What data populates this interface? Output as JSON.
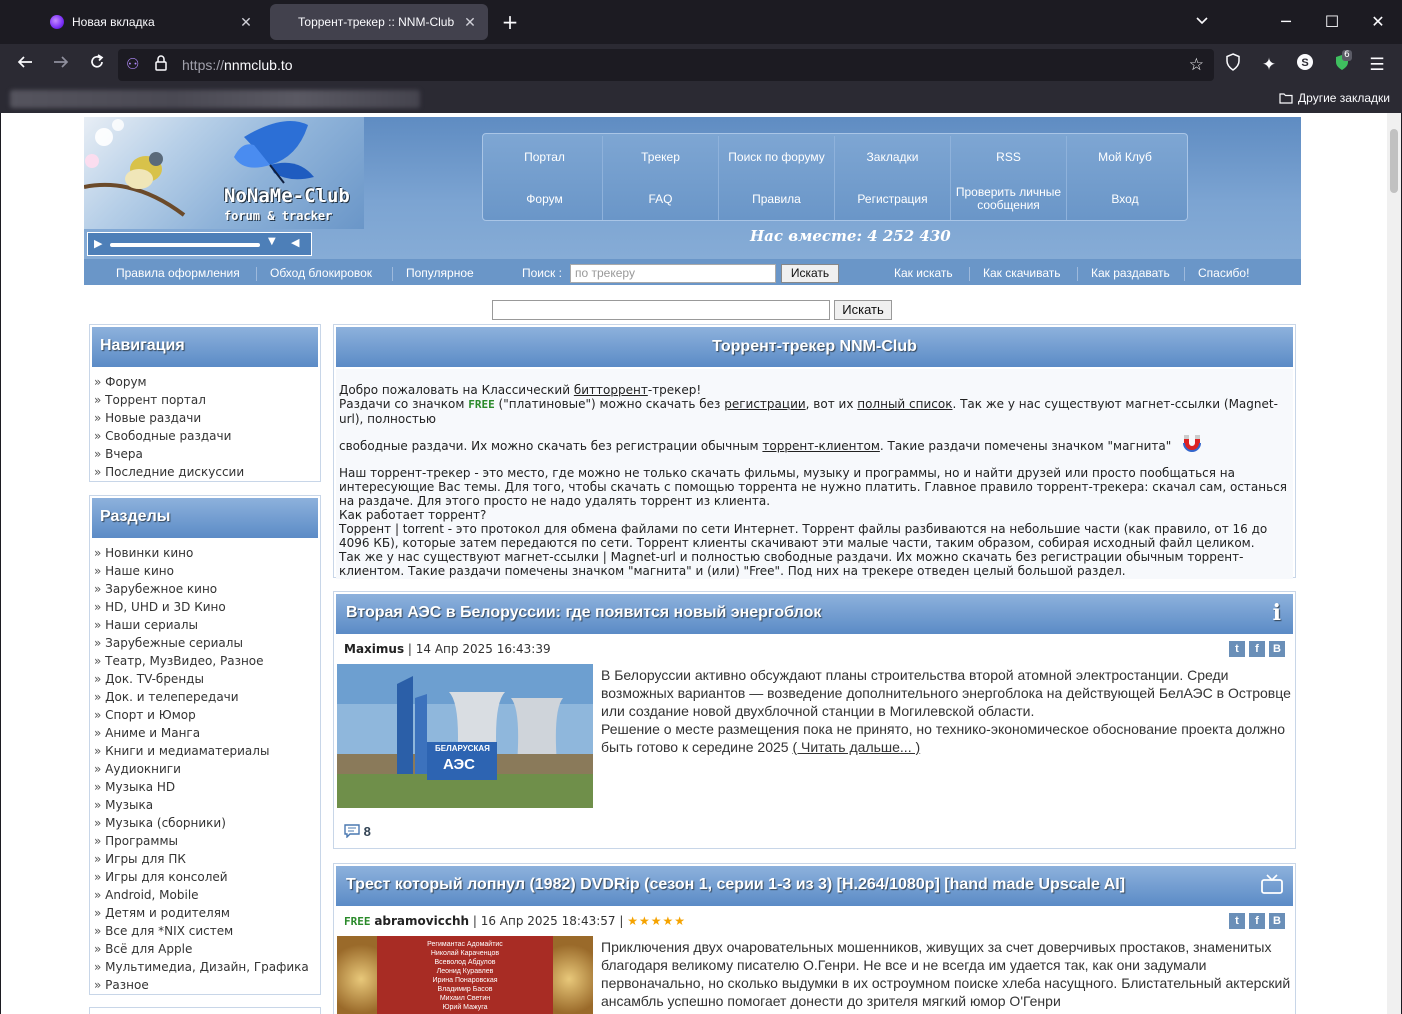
{
  "browser": {
    "tabs": [
      {
        "title": "Новая вкладка"
      },
      {
        "title": "Торрент-трекер :: NNM-Club"
      }
    ],
    "url_proto": "https://",
    "url_host": "nnmclub.to",
    "other_bookmarks": "Другие закладки",
    "ext_badge": "6"
  },
  "site": {
    "logo_title": "NoNaMe-Club",
    "logo_sub": "forum & tracker",
    "menu_row1": [
      "Портал",
      "Трекер",
      "Поиск по форуму",
      "Закладки",
      "RSS",
      "Мой Клуб"
    ],
    "menu_row2": [
      "Форум",
      "FAQ",
      "Правила",
      "Регистрация",
      "Проверить личные сообщения",
      "Вход"
    ],
    "together": "Нас вместе: 4 252 430",
    "nav_links_left": [
      "Правила оформления",
      "Обход блокировок",
      "Популярное"
    ],
    "search_label": "Поиск :",
    "search_placeholder": "по трекеру",
    "search_button": "Искать",
    "nav_links_right": [
      "Как искать",
      "Как скачивать",
      "Как раздавать",
      "Спасибо!"
    ],
    "main_search_button": "Искать"
  },
  "sidebar": {
    "nav_title": "Навигация",
    "nav_items": [
      "Форум",
      "Торрент портал",
      "Новые раздачи",
      "Свободные раздачи",
      "Вчера",
      "Последние дискуссии"
    ],
    "sections_title": "Разделы",
    "section_items": [
      "Новинки кино",
      "Наше кино",
      "Зарубежное кино",
      "HD, UHD и 3D Кино",
      "Наши сериалы",
      "Зарубежные сериалы",
      "Театр, МузВидео, Разное",
      "Док. TV-бренды",
      "Док. и телепередачи",
      "Спорт и Юмор",
      "Аниме и Манга",
      "Книги и медиаматериалы",
      "Аудиокниги",
      "Музыка HD",
      "Музыка",
      "Музыка (сборники)",
      "Программы",
      "Игры для ПК",
      "Игры для консолей",
      "Android, Mobile",
      "Детям и родителям",
      "Все для *NIX систем",
      "Всё для Apple",
      "Мультимедиа, Дизайн, Графика",
      "Разное"
    ]
  },
  "welcome": {
    "title": "Торрент-трекер NNM-Club",
    "l1a": "Добро пожаловать на Классический ",
    "l1link": "биттоppент",
    "l1b": "-трекер!",
    "l2a": "Раздачи со значком ",
    "free": "FREE",
    "l2b": " (\"платиновые\") можно скачать без ",
    "l2link1": "регистрации",
    "l2c": ", вот их ",
    "l2link2": "полный список",
    "l2d": ". Так же у нас существуют магнет-ссылки (Magnet-url), полностью",
    "l3a": "свободные раздачи. Их можно скачать без регистрации обычным ",
    "l3link": "торрент-клиентом",
    "l3b": ". Такие раздачи помечены значком \"магнита\"",
    "p2": "Наш торрент-трекер - это место, где можно не только скачать фильмы, музыку и программы, но и найти друзей или просто пообщаться на интересующие Вас темы. Для того, чтобы скачать с помощью торрента не нужно платить. Главное правило торрент-трекера: скачал сам, останься на раздаче. Для этого просто не надо удалять торрент из клиента.",
    "p3": "Как работает торрент?",
    "p4": "Торрент | torrent - это протокол для обмена файлами по сети Интернет. Торрент файлы разбиваются на небольшие части (как правило, от 16 до 4096 КБ), которые затем передаются по сети. Торрент клиенты скачивают эти малые части, таким образом, собирая исходный файл целиком.",
    "p5": "Так же у нас существуют магнет-ссылки | Magnet-url и полностью свободные раздачи. Их можно скачать без регистрации обычным торрент-клиентом. Такие раздачи помечены значком \"магнита\" и (или) \"Free\". Под них на трекере отведен целый большой раздел."
  },
  "news1": {
    "title": "Вторая АЭС в Белоруссии: где появится новый энергоблок",
    "author": "Maximus",
    "date": "14 Апр 2025 16:43:39",
    "p1": "В Белоруссии активно обсуждают планы строительства второй атомной электростанции. Среди возможных вариантов — возведение дополнительного энергоблока на действующей БелАЭС в Островце или создание новой двухблочной станции в Могилевской области.",
    "p2": "Решение о месте размещения пока не принято, но технико-экономическое обоснование проекта должно быть готово к середине 2025",
    "read_more": "( Читать дальше... )",
    "comments": "8",
    "img_sign1": "БЕЛАРУСКАЯ",
    "img_sign2": "АЭС"
  },
  "news2": {
    "title": "Трест который лопнул (1982) DVDRip (сезон 1, серии 1-3 из 3) [H.264/1080p] [hand made Upscale AI]",
    "free": "FREE",
    "author": "abramovicchh",
    "date": "16 Апр 2025 18:43:57",
    "stars": "★★★★★",
    "p1": "Приключения двух очаровательных мошенников, живущих за счет доверчивых простаков, знаменитых благодаря великому писателю О.Генри. Не все и не всегда им удается так, как они задумали первоначально, но сколько выдумки в их остроумном поиске хлеба насущного. Блистательный актерский ансамбль успешно помогает донести до зрителя мягкий юмор О'Генри",
    "poster_names": [
      "Регимантас Адомайтис",
      "Николай Караченцов",
      "Всеволод Абдулов",
      "Леонид Куравлев",
      "Ирина Понаровская",
      "Владимир Басов",
      "Михаил Светин",
      "Юрий Мажуга"
    ]
  },
  "icons": {
    "share": [
      "t",
      "f",
      "B"
    ]
  }
}
